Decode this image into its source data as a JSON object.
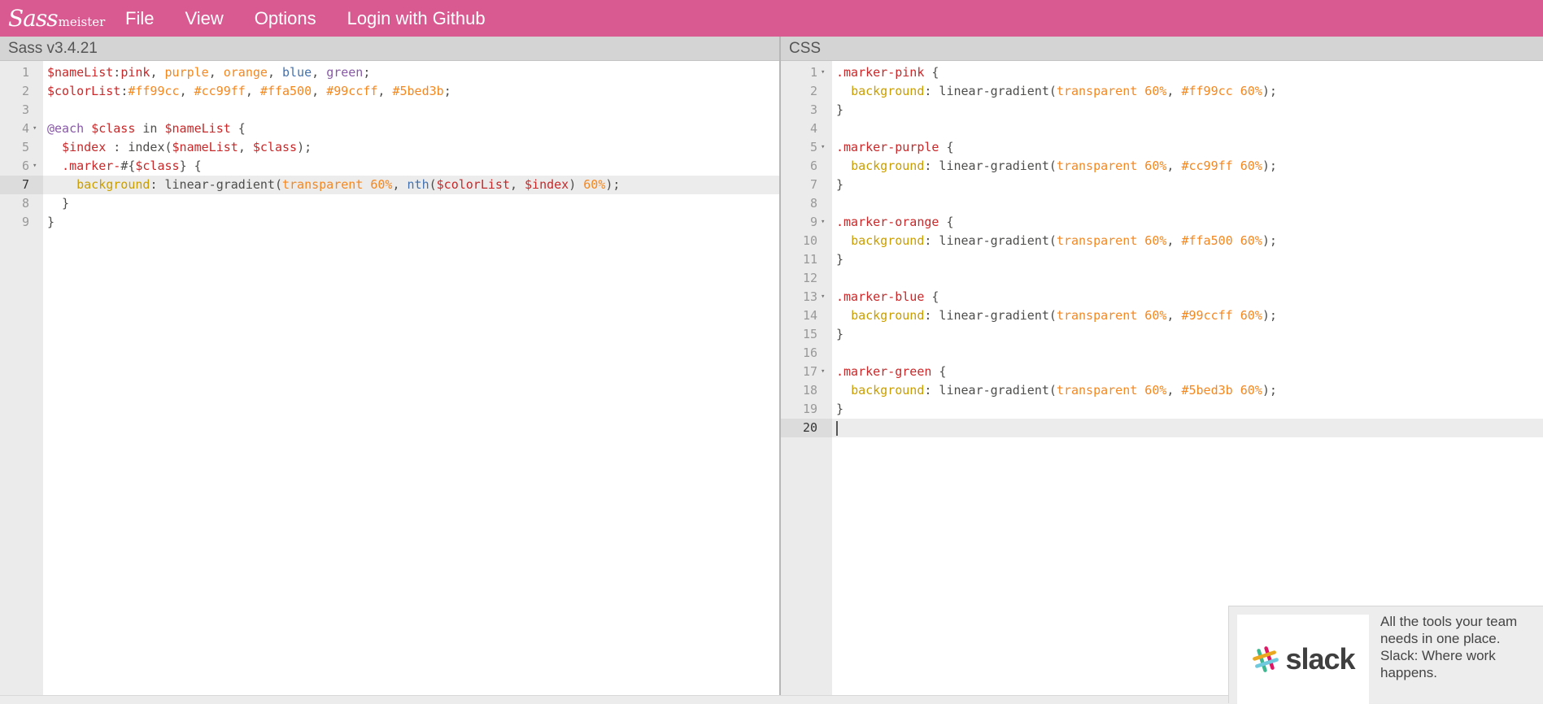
{
  "topbar": {
    "logo_script": "Sass",
    "logo_suffix": "meister",
    "menu": [
      "File",
      "View",
      "Options",
      "Login with Github"
    ]
  },
  "left_pane": {
    "title": "Sass v3.4.21",
    "active_line": 7,
    "lines": [
      {
        "n": "1",
        "fold": false,
        "tokens": [
          [
            "var",
            "$nameList"
          ],
          [
            "plain",
            ":"
          ],
          [
            "var",
            "pink"
          ],
          [
            "plain",
            ", "
          ],
          [
            "num",
            "purple"
          ],
          [
            "plain",
            ", "
          ],
          [
            "num",
            "orange"
          ],
          [
            "plain",
            ", "
          ],
          [
            "fn",
            "blue"
          ],
          [
            "plain",
            ", "
          ],
          [
            "kw",
            "green"
          ],
          [
            "plain",
            ";"
          ]
        ]
      },
      {
        "n": "2",
        "fold": false,
        "tokens": [
          [
            "var",
            "$colorList"
          ],
          [
            "plain",
            ":"
          ],
          [
            "num",
            "#ff99cc"
          ],
          [
            "plain",
            ", "
          ],
          [
            "num",
            "#cc99ff"
          ],
          [
            "plain",
            ", "
          ],
          [
            "num",
            "#ffa500"
          ],
          [
            "plain",
            ", "
          ],
          [
            "num",
            "#99ccff"
          ],
          [
            "plain",
            ", "
          ],
          [
            "num",
            "#5bed3b"
          ],
          [
            "plain",
            ";"
          ]
        ]
      },
      {
        "n": "3",
        "fold": false,
        "tokens": []
      },
      {
        "n": "4",
        "fold": true,
        "tokens": [
          [
            "at",
            "@each"
          ],
          [
            "plain",
            " "
          ],
          [
            "var",
            "$class"
          ],
          [
            "plain",
            " in "
          ],
          [
            "var",
            "$nameList"
          ],
          [
            "plain",
            " {"
          ]
        ]
      },
      {
        "n": "5",
        "fold": false,
        "tokens": [
          [
            "plain",
            "  "
          ],
          [
            "var",
            "$index"
          ],
          [
            "plain",
            " : index("
          ],
          [
            "var",
            "$nameList"
          ],
          [
            "plain",
            ", "
          ],
          [
            "var",
            "$class"
          ],
          [
            "plain",
            ");"
          ]
        ]
      },
      {
        "n": "6",
        "fold": true,
        "tokens": [
          [
            "plain",
            "  "
          ],
          [
            "sel",
            ".marker-"
          ],
          [
            "plain",
            "#{"
          ],
          [
            "var",
            "$class"
          ],
          [
            "plain",
            "} {"
          ]
        ]
      },
      {
        "n": "7",
        "fold": false,
        "tokens": [
          [
            "plain",
            "    "
          ],
          [
            "prop",
            "background"
          ],
          [
            "plain",
            ": linear-gradient("
          ],
          [
            "num",
            "transparent 60%"
          ],
          [
            "plain",
            ", "
          ],
          [
            "fn",
            "nth"
          ],
          [
            "plain",
            "("
          ],
          [
            "var",
            "$colorList"
          ],
          [
            "plain",
            ", "
          ],
          [
            "var",
            "$index"
          ],
          [
            "plain",
            ") "
          ],
          [
            "num",
            "60%"
          ],
          [
            "plain",
            ");"
          ]
        ]
      },
      {
        "n": "8",
        "fold": false,
        "tokens": [
          [
            "plain",
            "  }"
          ]
        ]
      },
      {
        "n": "9",
        "fold": false,
        "tokens": [
          [
            "plain",
            "}"
          ]
        ]
      }
    ]
  },
  "right_pane": {
    "title": "CSS",
    "active_line": 20,
    "lines": [
      {
        "n": "1",
        "fold": true,
        "tokens": [
          [
            "sel",
            ".marker-pink"
          ],
          [
            "plain",
            " {"
          ]
        ]
      },
      {
        "n": "2",
        "fold": false,
        "tokens": [
          [
            "plain",
            "  "
          ],
          [
            "prop",
            "background"
          ],
          [
            "plain",
            ": linear-gradient("
          ],
          [
            "num",
            "transparent 60%"
          ],
          [
            "plain",
            ", "
          ],
          [
            "num",
            "#ff99cc 60%"
          ],
          [
            "plain",
            ");"
          ]
        ]
      },
      {
        "n": "3",
        "fold": false,
        "tokens": [
          [
            "plain",
            "}"
          ]
        ]
      },
      {
        "n": "4",
        "fold": false,
        "tokens": []
      },
      {
        "n": "5",
        "fold": true,
        "tokens": [
          [
            "sel",
            ".marker-purple"
          ],
          [
            "plain",
            " {"
          ]
        ]
      },
      {
        "n": "6",
        "fold": false,
        "tokens": [
          [
            "plain",
            "  "
          ],
          [
            "prop",
            "background"
          ],
          [
            "plain",
            ": linear-gradient("
          ],
          [
            "num",
            "transparent 60%"
          ],
          [
            "plain",
            ", "
          ],
          [
            "num",
            "#cc99ff 60%"
          ],
          [
            "plain",
            ");"
          ]
        ]
      },
      {
        "n": "7",
        "fold": false,
        "tokens": [
          [
            "plain",
            "}"
          ]
        ]
      },
      {
        "n": "8",
        "fold": false,
        "tokens": []
      },
      {
        "n": "9",
        "fold": true,
        "tokens": [
          [
            "sel",
            ".marker-orange"
          ],
          [
            "plain",
            " {"
          ]
        ]
      },
      {
        "n": "10",
        "fold": false,
        "tokens": [
          [
            "plain",
            "  "
          ],
          [
            "prop",
            "background"
          ],
          [
            "plain",
            ": linear-gradient("
          ],
          [
            "num",
            "transparent 60%"
          ],
          [
            "plain",
            ", "
          ],
          [
            "num",
            "#ffa500 60%"
          ],
          [
            "plain",
            ");"
          ]
        ]
      },
      {
        "n": "11",
        "fold": false,
        "tokens": [
          [
            "plain",
            "}"
          ]
        ]
      },
      {
        "n": "12",
        "fold": false,
        "tokens": []
      },
      {
        "n": "13",
        "fold": true,
        "tokens": [
          [
            "sel",
            ".marker-blue"
          ],
          [
            "plain",
            " {"
          ]
        ]
      },
      {
        "n": "14",
        "fold": false,
        "tokens": [
          [
            "plain",
            "  "
          ],
          [
            "prop",
            "background"
          ],
          [
            "plain",
            ": linear-gradient("
          ],
          [
            "num",
            "transparent 60%"
          ],
          [
            "plain",
            ", "
          ],
          [
            "num",
            "#99ccff 60%"
          ],
          [
            "plain",
            ");"
          ]
        ]
      },
      {
        "n": "15",
        "fold": false,
        "tokens": [
          [
            "plain",
            "}"
          ]
        ]
      },
      {
        "n": "16",
        "fold": false,
        "tokens": []
      },
      {
        "n": "17",
        "fold": true,
        "tokens": [
          [
            "sel",
            ".marker-green"
          ],
          [
            "plain",
            " {"
          ]
        ]
      },
      {
        "n": "18",
        "fold": false,
        "tokens": [
          [
            "plain",
            "  "
          ],
          [
            "prop",
            "background"
          ],
          [
            "plain",
            ": linear-gradient("
          ],
          [
            "num",
            "transparent 60%"
          ],
          [
            "plain",
            ", "
          ],
          [
            "num",
            "#5bed3b 60%"
          ],
          [
            "plain",
            ");"
          ]
        ]
      },
      {
        "n": "19",
        "fold": false,
        "tokens": [
          [
            "plain",
            "}"
          ]
        ]
      },
      {
        "n": "20",
        "fold": false,
        "tokens": [],
        "cursor": true
      }
    ]
  },
  "ad": {
    "brand": "slack",
    "text": "All the tools your team needs in one place. Slack: Where work happens."
  },
  "colors": {
    "topbar": "#d95991",
    "gutter": "#ebebeb",
    "pane_header": "#d4d4d4",
    "token_variable": "#c82829",
    "token_property": "#c99e00",
    "token_number": "#f5871f",
    "token_keyword": "#8959a8",
    "token_function": "#4271ae"
  },
  "icons": {
    "fold": "triangle-down-icon",
    "ad_logo": "slack-hash-icon"
  }
}
